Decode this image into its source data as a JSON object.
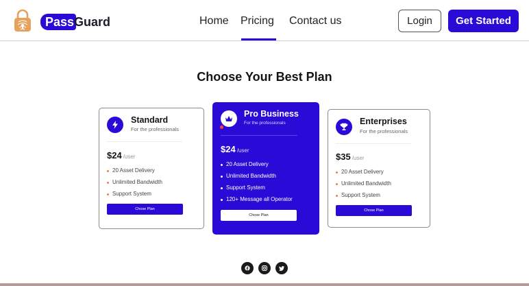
{
  "brand": {
    "pass": "Pass",
    "guard": "Guard",
    "logo_icon": "padlock-fingerprint-icon",
    "accent": "#2a0ad6",
    "logo_color": "#e5a25c"
  },
  "nav": {
    "home": "Home",
    "pricing": "Pricing",
    "contact": "Contact us",
    "active": "Pricing"
  },
  "header_actions": {
    "login": "Login",
    "get_started": "Get Started"
  },
  "section_title": "Choose Your Best Plan",
  "plans": [
    {
      "name": "Standard",
      "subtitle": "For the professionals",
      "icon": "lightning-icon",
      "price": "$24",
      "unit": "/user",
      "features": [
        "20 Asset Delivery",
        "Unlimited Bandwidth",
        "Support System"
      ],
      "button": "Chose Plan",
      "highlighted": false
    },
    {
      "name": "Pro Business",
      "subtitle": "For the professionals",
      "icon": "crown-icon",
      "price": "$24",
      "unit": "/user",
      "features": [
        "20 Asset Delivery",
        "Unlimited Bandwidth",
        "Support System",
        "120+ Message all Operator"
      ],
      "button": "Chose Plan",
      "highlighted": true
    },
    {
      "name": "Enterprises",
      "subtitle": "For the professionals",
      "icon": "trophy-icon",
      "price": "$35",
      "unit": "/user",
      "features": [
        "20 Asset Delivery",
        "Unlimited Bandwidth",
        "Support System"
      ],
      "button": "Chose Plan",
      "highlighted": false
    }
  ],
  "social": [
    "facebook-icon",
    "instagram-icon",
    "twitter-icon"
  ]
}
